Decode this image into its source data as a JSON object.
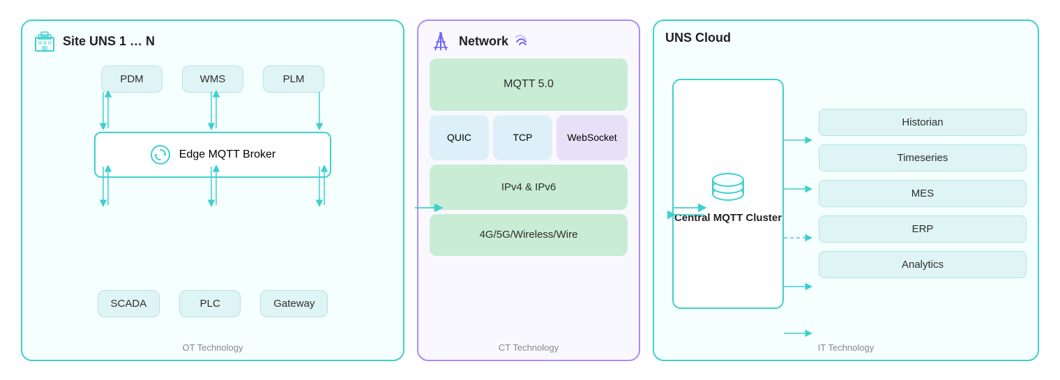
{
  "site_panel": {
    "title": "Site UNS 1 … N",
    "subtitle": "OT Technology",
    "top_boxes": [
      "PDM",
      "WMS",
      "PLM"
    ],
    "broker_label": "Edge MQTT Broker",
    "bottom_boxes": [
      "SCADA",
      "PLC",
      "Gateway"
    ]
  },
  "network_panel": {
    "title": "Network",
    "subtitle": "CT Technology",
    "blocks": [
      {
        "label": "MQTT 5.0",
        "type": "green"
      },
      {
        "label": "QUIC",
        "type": "blue"
      },
      {
        "label": "TCP",
        "type": "blue"
      },
      {
        "label": "WebSocket",
        "type": "purple"
      },
      {
        "label": "IPv4 & IPv6",
        "type": "green"
      },
      {
        "label": "4G/5G/Wireless/Wire",
        "type": "green"
      }
    ]
  },
  "cloud_panel": {
    "title": "UNS Cloud",
    "subtitle": "IT Technology",
    "cluster_label": "Central\nMQTT Cluster",
    "services": [
      "Historian",
      "Timeseries",
      "MES",
      "ERP",
      "Analytics"
    ]
  }
}
